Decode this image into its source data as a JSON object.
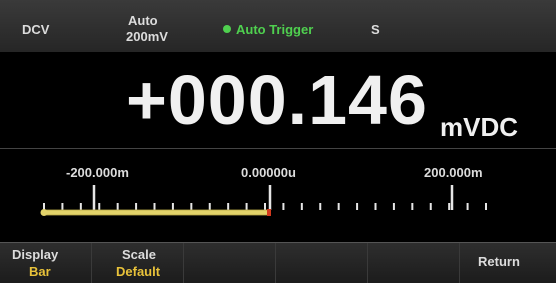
{
  "status": {
    "function": "DCV",
    "range_mode": "Auto",
    "range_value": "200mV",
    "trigger": "Auto Trigger",
    "speed": "S"
  },
  "reading": {
    "value": "+000.146",
    "unit": "mVDC"
  },
  "bar_graph": {
    "left_label": "-200.000m",
    "center_label": "0.00000u",
    "right_label": "200.000m",
    "fill_fraction": 0.5,
    "colors": {
      "fill": "#e3d36a",
      "fill_outline": "#b8a845",
      "end_marker": "#d23a1e",
      "ticks": "#e6e6e6"
    }
  },
  "softkeys": {
    "display_label": "Display",
    "display_value": "Bar",
    "scale_label": "Scale",
    "scale_value": "Default",
    "return_label": "Return"
  }
}
